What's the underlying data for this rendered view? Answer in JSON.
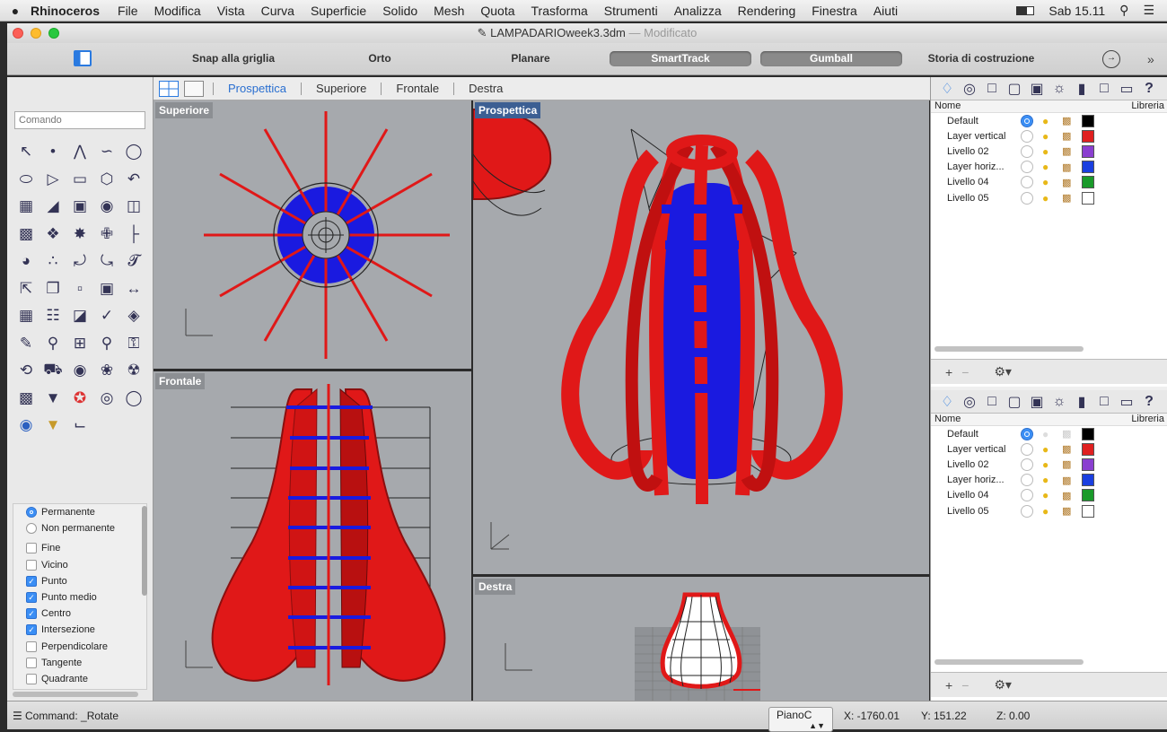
{
  "menubar": {
    "apple": "",
    "app": "Rhinoceros",
    "items": [
      "File",
      "Modifica",
      "Vista",
      "Curva",
      "Superficie",
      "Solido",
      "Mesh",
      "Quota",
      "Trasforma",
      "Strumenti",
      "Analizza",
      "Rendering",
      "Finestra",
      "Aiuti"
    ],
    "clock": "Sab 15.11"
  },
  "window": {
    "title": "LAMPADARIOweek3.3dm",
    "modified": "— Modificato"
  },
  "toolbar": {
    "snap_grid": "Snap alla griglia",
    "orto": "Orto",
    "planare": "Planare",
    "smarttrack": "SmartTrack",
    "gumball": "Gumball",
    "history": "Storia di costruzione"
  },
  "command": {
    "placeholder": "Comando"
  },
  "viewport_tabs": [
    "Prospettica",
    "Superiore",
    "Frontale",
    "Destra"
  ],
  "viewports": {
    "top": "Superiore",
    "front": "Frontale",
    "perspective": "Prospettica",
    "right": "Destra"
  },
  "osnap": {
    "radios": [
      {
        "label": "Permanente",
        "on": true
      },
      {
        "label": "Non permanente",
        "on": false
      }
    ],
    "checks": [
      {
        "label": "Fine",
        "on": false
      },
      {
        "label": "Vicino",
        "on": false
      },
      {
        "label": "Punto",
        "on": true
      },
      {
        "label": "Punto medio",
        "on": true
      },
      {
        "label": "Centro",
        "on": true
      },
      {
        "label": "Intersezione",
        "on": true
      },
      {
        "label": "Perpendicolare",
        "on": false
      },
      {
        "label": "Tangente",
        "on": false
      },
      {
        "label": "Quadrante",
        "on": false
      }
    ]
  },
  "layers_panel": {
    "col_name": "Nome",
    "col_lib": "Libreria",
    "layers": [
      {
        "name": "Default",
        "current": true,
        "color": "#000000"
      },
      {
        "name": "Layer vertical",
        "current": false,
        "color": "#e02020"
      },
      {
        "name": "Livello 02",
        "current": false,
        "color": "#8a3fd0"
      },
      {
        "name": "Layer horiz...",
        "current": false,
        "color": "#1a3fe0"
      },
      {
        "name": "Livello 04",
        "current": false,
        "color": "#1a9a2a"
      },
      {
        "name": "Livello 05",
        "current": false,
        "color": "#ffffff"
      }
    ]
  },
  "status": {
    "command": "Command: _Rotate",
    "plane": "PianoC",
    "x": "X: -1760.01",
    "y": "Y: 151.22",
    "z": "Z: 0.00"
  }
}
